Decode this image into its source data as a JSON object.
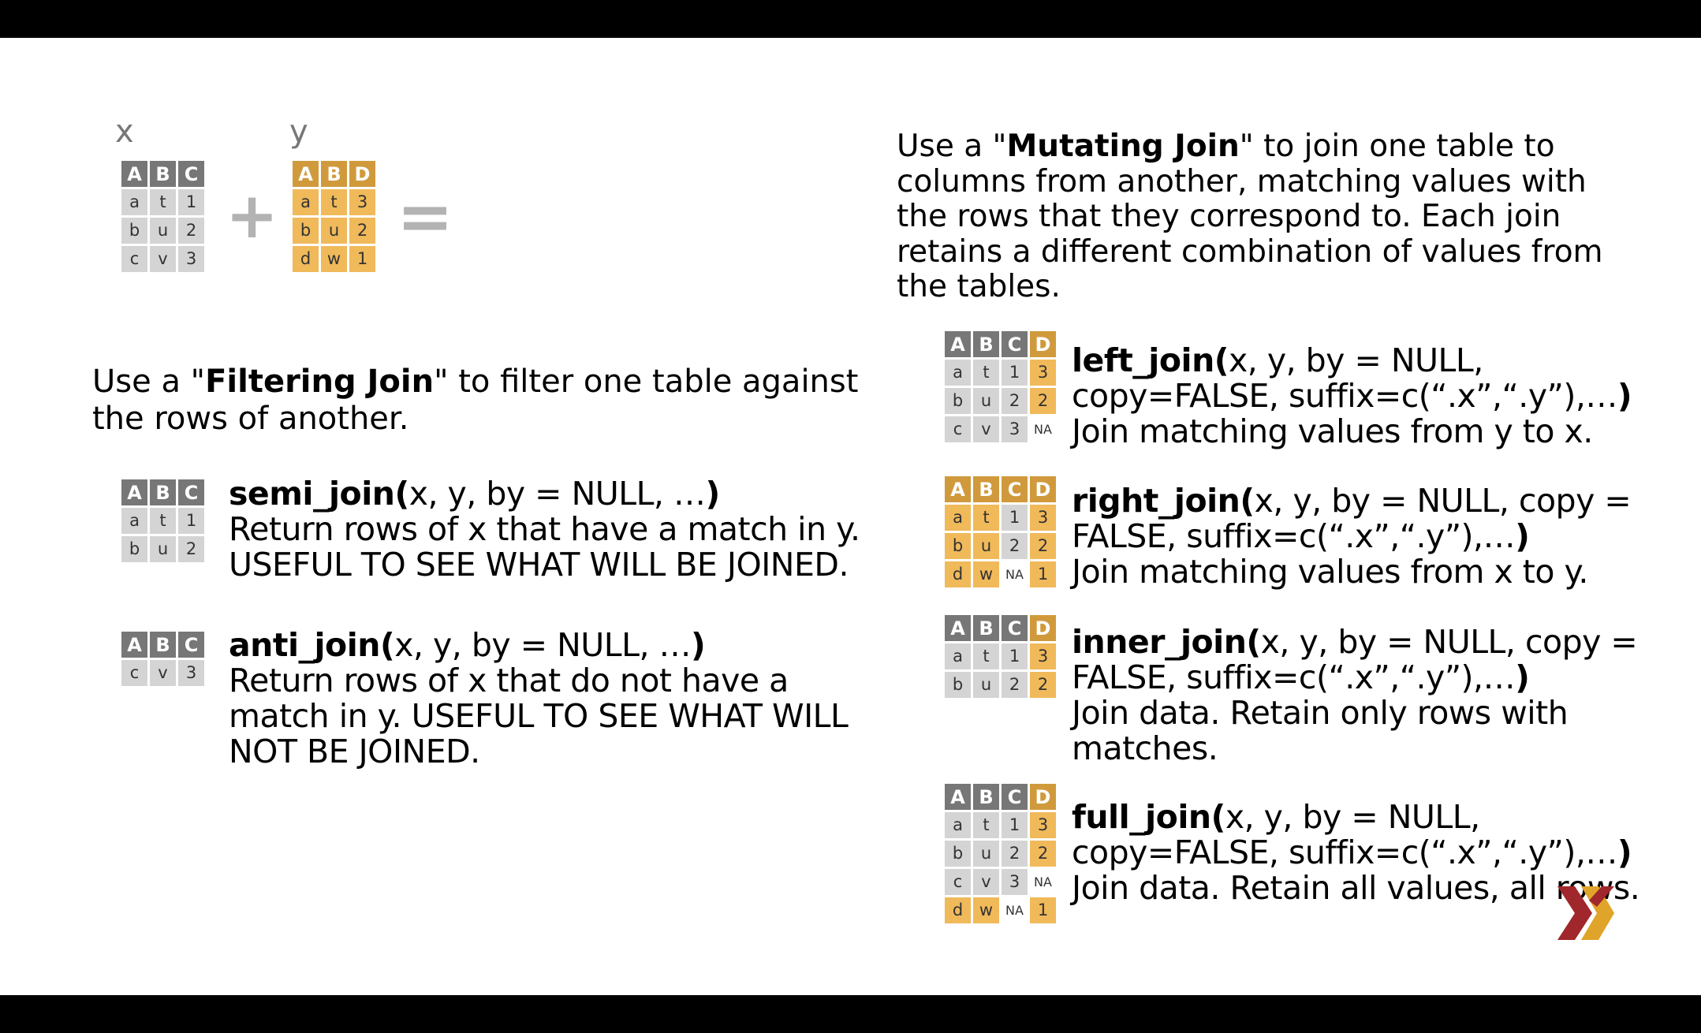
{
  "header": {
    "x_label": "x",
    "y_label": "y",
    "plus": "+",
    "equals": "="
  },
  "tables": {
    "x": {
      "header": [
        "A",
        "B",
        "C"
      ],
      "rows": [
        [
          "a",
          "t",
          "1"
        ],
        [
          "b",
          "u",
          "2"
        ],
        [
          "c",
          "v",
          "3"
        ]
      ]
    },
    "y": {
      "header": [
        "A",
        "B",
        "D"
      ],
      "rows": [
        [
          "a",
          "t",
          "3"
        ],
        [
          "b",
          "u",
          "2"
        ],
        [
          "d",
          "w",
          "1"
        ]
      ]
    },
    "semi": {
      "header": [
        "A",
        "B",
        "C"
      ],
      "rows": [
        [
          "a",
          "t",
          "1"
        ],
        [
          "b",
          "u",
          "2"
        ]
      ]
    },
    "anti": {
      "header": [
        "A",
        "B",
        "C"
      ],
      "rows": [
        [
          "c",
          "v",
          "3"
        ]
      ]
    },
    "left": {
      "header": [
        "A",
        "B",
        "C",
        "D"
      ],
      "rows": [
        [
          "a",
          "t",
          "1",
          "3"
        ],
        [
          "b",
          "u",
          "2",
          "2"
        ],
        [
          "c",
          "v",
          "3",
          "NA"
        ]
      ]
    },
    "right": {
      "header": [
        "A",
        "B",
        "C",
        "D"
      ],
      "rows": [
        [
          "a",
          "t",
          "1",
          "3"
        ],
        [
          "b",
          "u",
          "2",
          "2"
        ],
        [
          "d",
          "w",
          "NA",
          "1"
        ]
      ]
    },
    "inner": {
      "header": [
        "A",
        "B",
        "C",
        "D"
      ],
      "rows": [
        [
          "a",
          "t",
          "1",
          "3"
        ],
        [
          "b",
          "u",
          "2",
          "2"
        ]
      ]
    },
    "full": {
      "header": [
        "A",
        "B",
        "C",
        "D"
      ],
      "rows": [
        [
          "a",
          "t",
          "1",
          "3"
        ],
        [
          "b",
          "u",
          "2",
          "2"
        ],
        [
          "c",
          "v",
          "3",
          "NA"
        ],
        [
          "d",
          "w",
          "NA",
          "1"
        ]
      ]
    }
  },
  "filtering": {
    "intro_prefix": "Use a \"",
    "intro_bold": "Filtering Join",
    "intro_suffix": "\" to filter one table against",
    "intro_line2": "the rows of another.",
    "semi_name": "semi_join(",
    "semi_args": "x, y, by = NULL, …",
    "semi_close": ")",
    "semi_desc1": "Return rows of x that have a match in y.",
    "semi_desc2": "USEFUL TO SEE WHAT WILL BE JOINED.",
    "anti_name": "anti_join(",
    "anti_args": "x, y, by = NULL, …",
    "anti_close": ")",
    "anti_desc1": "Return rows of x that do not have a",
    "anti_desc2": "match in y. USEFUL TO SEE WHAT WILL",
    "anti_desc3": "NOT BE JOINED."
  },
  "mutating": {
    "intro_prefix": "Use a \"",
    "intro_bold": "Mutating Join",
    "intro_suffix": "\" to join one table to",
    "intro_line2": "columns from another, matching values with",
    "intro_line3": "the rows that they correspond to.  Each join",
    "intro_line4": "retains a different combination of values from",
    "intro_line5": "the tables.",
    "left_name": "left_join(",
    "left_args1": "x, y, by = NULL,",
    "left_args2": "copy=FALSE,  suffix=c(“.x”,“.y”),…",
    "left_close": ")",
    "left_desc": "Join matching values from y to x.",
    "right_name": "right_join(",
    "right_args1": "x, y, by = NULL, copy =",
    "right_args2": "FALSE,  suffix=c(“.x”,“.y”),…",
    "right_close": ")",
    "right_desc": "Join matching values from x to y.",
    "inner_name": "inner_join(",
    "inner_args1": "x, y, by = NULL, copy =",
    "inner_args2": "FALSE,  suffix=c(“.x”,“.y”),…",
    "inner_close": ")",
    "inner_desc1": "Join data. Retain only rows with",
    "inner_desc2": "matches.",
    "full_name": "full_join(",
    "full_args1": "x, y, by = NULL,",
    "full_args2": "copy=FALSE,  suffix=c(“.x”,“.y”),…",
    "full_close": ")",
    "full_desc": "Join data. Retain all values, all rows."
  },
  "colors": {
    "x_header": "#777777",
    "x_cell": "#d4d4d4",
    "y_header": "#d09a3c",
    "y_cell": "#f0b95a",
    "logo": "#a0272b"
  },
  "logo": {
    "icon": "x-logo-icon"
  }
}
